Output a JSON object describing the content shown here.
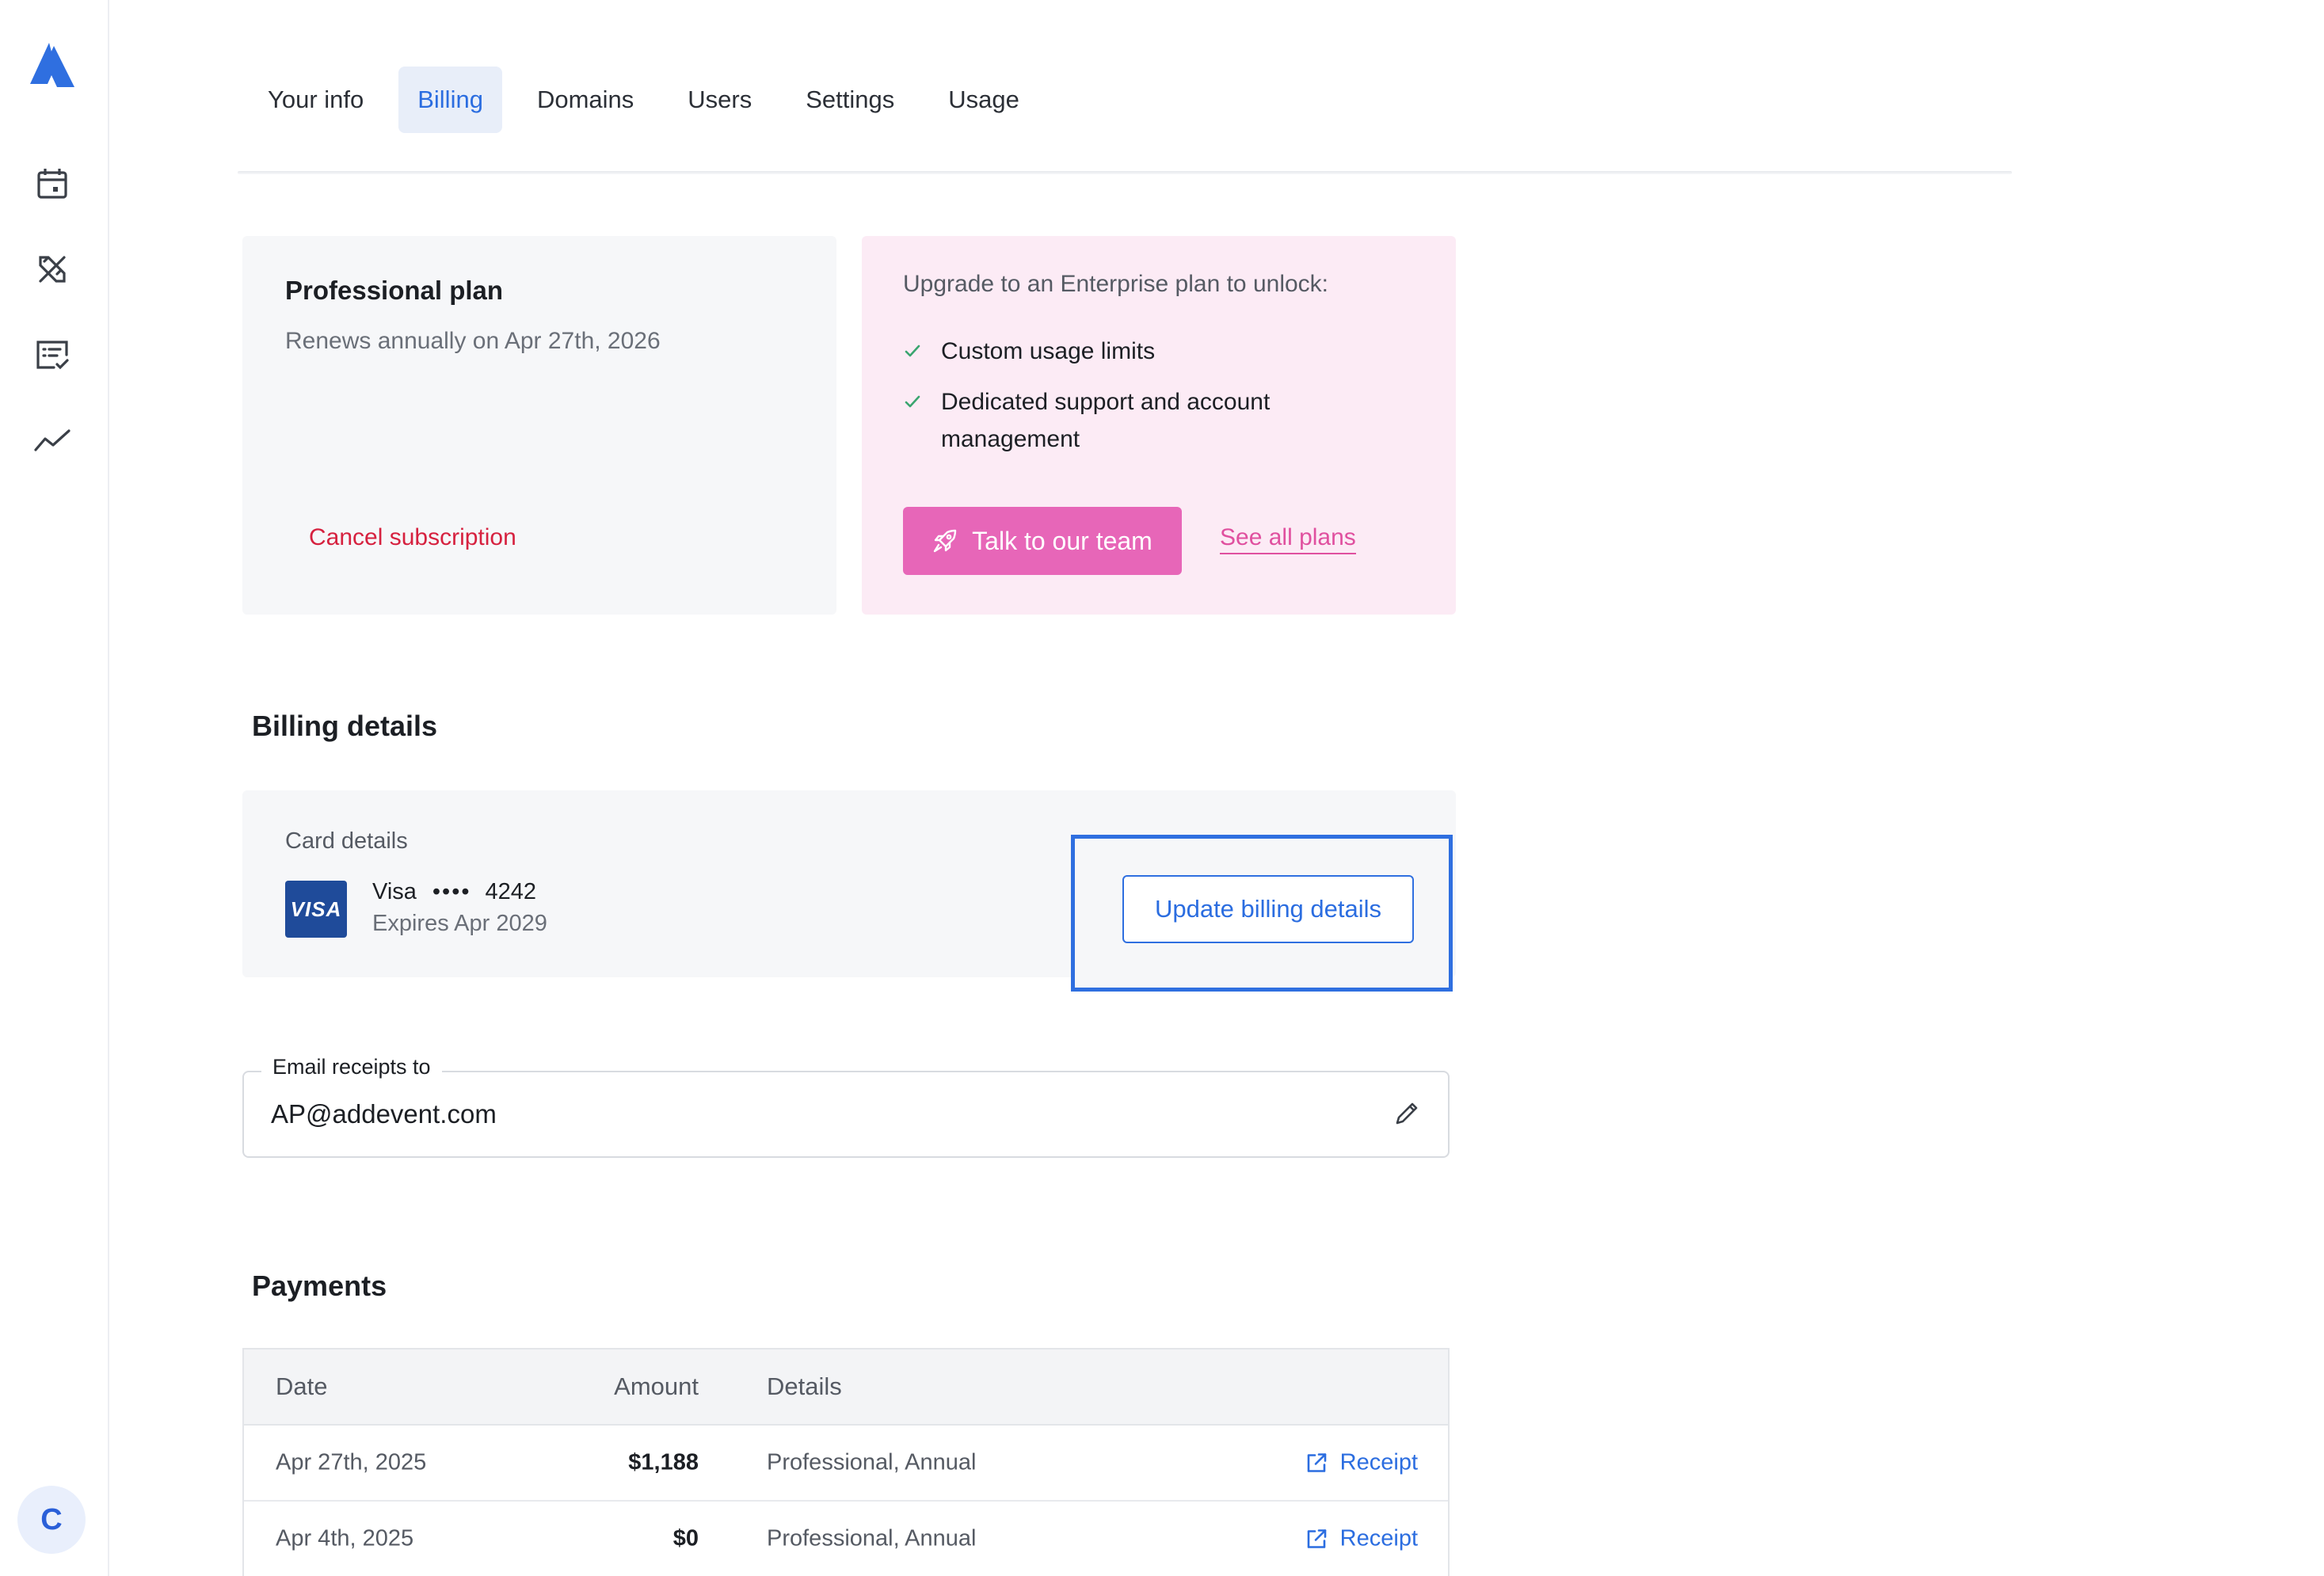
{
  "sidebar": {
    "logo_icon": "addevent-logo-icon",
    "items": [
      {
        "icon": "calendar-icon"
      },
      {
        "icon": "design-tools-icon"
      },
      {
        "icon": "checklist-icon"
      },
      {
        "icon": "analytics-icon"
      }
    ],
    "avatar_initial": "C"
  },
  "tabs": [
    {
      "label": "Your info",
      "active": false
    },
    {
      "label": "Billing",
      "active": true
    },
    {
      "label": "Domains",
      "active": false
    },
    {
      "label": "Users",
      "active": false
    },
    {
      "label": "Settings",
      "active": false
    },
    {
      "label": "Usage",
      "active": false
    }
  ],
  "plan": {
    "title": "Professional plan",
    "renew_text": "Renews annually on Apr 27th, 2026",
    "cancel_label": "Cancel subscription"
  },
  "upgrade": {
    "title": "Upgrade to an Enterprise plan to unlock:",
    "features": [
      "Custom usage limits",
      "Dedicated support and account management"
    ],
    "feature2_line1": "Dedicated support and account",
    "feature2_line2": "management",
    "talk_label": "Talk to our team",
    "see_plans_label": "See all plans"
  },
  "billing": {
    "section_title": "Billing details",
    "card_label": "Card details",
    "card_logo_text": "VISA",
    "card_brand": "Visa",
    "card_dots": "••••",
    "card_last4": "4242",
    "card_expiry": "Expires Apr 2029",
    "update_label": "Update billing details"
  },
  "email": {
    "label": "Email receipts to",
    "value": "AP@addevent.com"
  },
  "payments": {
    "section_title": "Payments",
    "columns": {
      "date": "Date",
      "amount": "Amount",
      "details": "Details"
    },
    "rows": [
      {
        "date": "Apr 27th, 2025",
        "amount": "$1,188",
        "details": "Professional, Annual",
        "receipt": "Receipt"
      },
      {
        "date": "Apr 4th, 2025",
        "amount": "$0",
        "details": "Professional, Annual",
        "receipt": "Receipt"
      }
    ]
  },
  "colors": {
    "accent_blue": "#2b6de0",
    "upgrade_pink": "#e766b8",
    "danger_red": "#d6213f",
    "check_green": "#3aa56f"
  }
}
